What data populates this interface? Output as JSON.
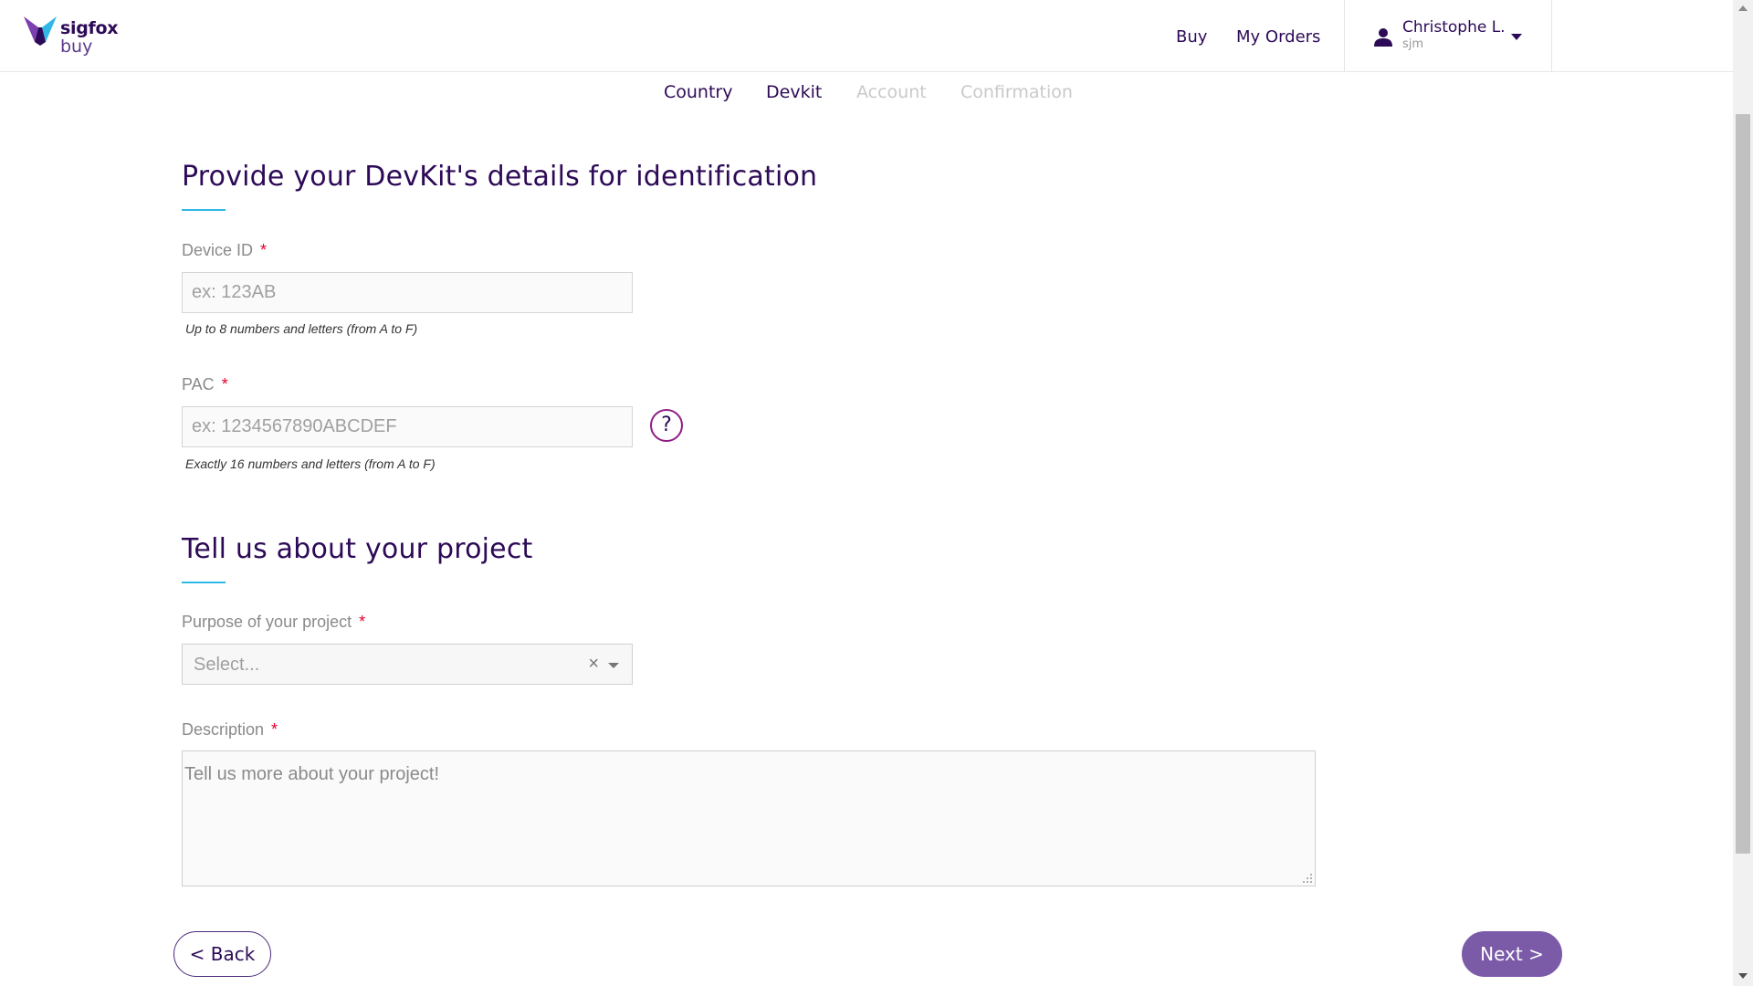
{
  "header": {
    "logo_line1": "sigfox",
    "logo_line2": "buy",
    "nav": {
      "buy": "Buy",
      "my_orders": "My Orders"
    },
    "user": {
      "name": "Christophe L.",
      "sub": "sjm"
    }
  },
  "steps": [
    {
      "label": "Country",
      "state": "done"
    },
    {
      "label": "Devkit",
      "state": "done"
    },
    {
      "label": "Account",
      "state": "todo"
    },
    {
      "label": "Confirmation",
      "state": "todo"
    }
  ],
  "devkit_section": {
    "title": "Provide your DevKit's details for identification",
    "device_id": {
      "label": "Device ID",
      "required_mark": "*",
      "placeholder": "ex: 123AB",
      "value": "",
      "hint": "Up to 8 numbers and letters (from A to F)"
    },
    "pac": {
      "label": "PAC",
      "required_mark": "*",
      "placeholder": "ex: 1234567890ABCDEF",
      "value": "",
      "hint": "Exactly 16 numbers and letters (from A to F)",
      "help_label": "?"
    }
  },
  "project_section": {
    "title": "Tell us about your project",
    "purpose": {
      "label": "Purpose of your project",
      "required_mark": "*",
      "selected": "Select...",
      "clear_label": "×"
    },
    "description": {
      "label": "Description",
      "required_mark": "*",
      "placeholder": "Tell us more about your project!",
      "value": ""
    }
  },
  "buttons": {
    "back": "< Back",
    "next": "Next >"
  },
  "colors": {
    "brand_dark": "#2d0a57",
    "accent_underline": "#2fb8e6",
    "required": "#e5002b",
    "next_button": "#7b5ba8",
    "help_circle": "#8e1d86"
  }
}
